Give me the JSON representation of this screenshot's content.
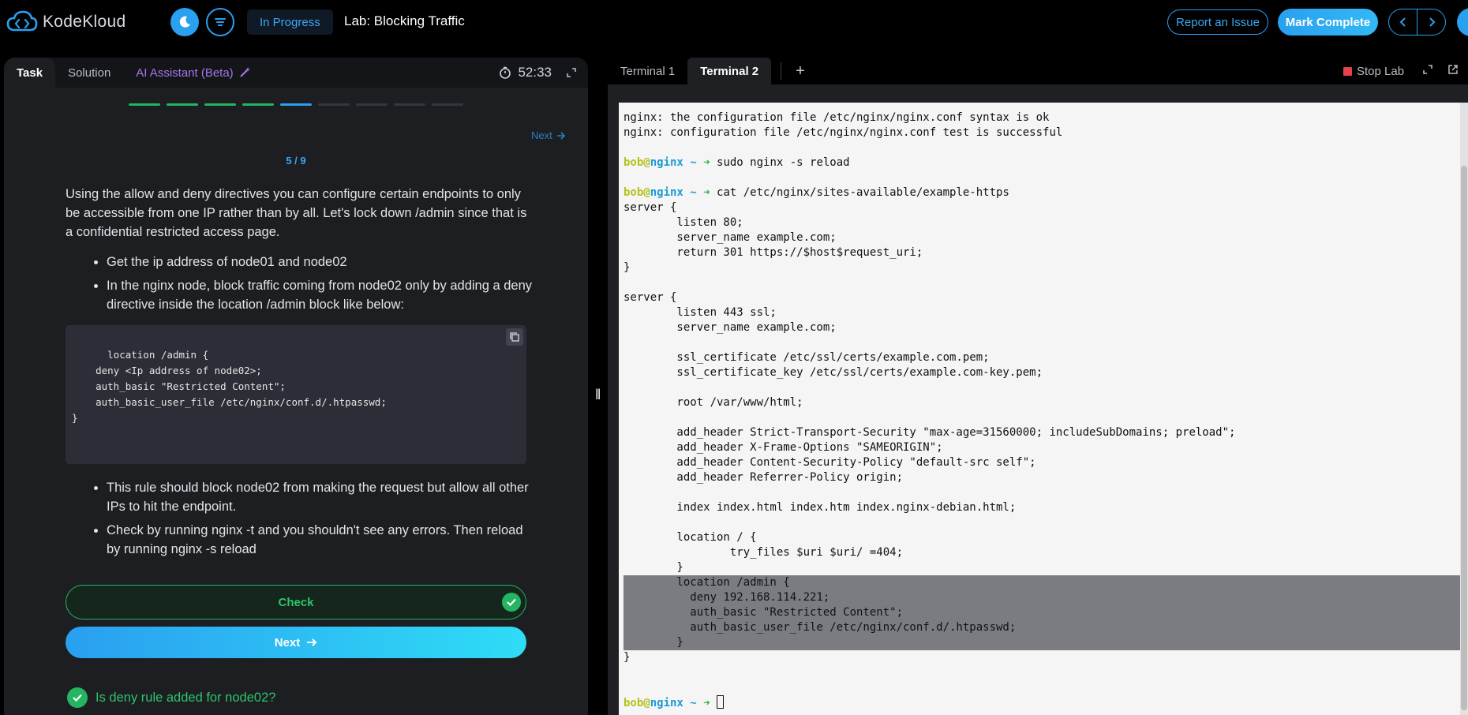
{
  "header": {
    "brand": "KodeKloud",
    "status": "In Progress",
    "lab_title": "Lab: Blocking Traffic",
    "report_label": "Report an Issue",
    "complete_label": "Mark Complete"
  },
  "left": {
    "tabs": [
      {
        "label": "Task"
      },
      {
        "label": "Solution"
      },
      {
        "label": "AI Assistant (Beta)"
      }
    ],
    "timer": "52:33",
    "next_link": "Next",
    "step": "5 / 9",
    "progress": {
      "done": 4,
      "current": 5,
      "total": 9
    },
    "intro": "Using the allow and deny directives you can configure certain endpoints to only be accessible from one IP rather than by all. Let's lock down /admin since that is a confidential restricted access page.",
    "bullets1": [
      "Get the ip address of node01 and node02",
      "In the nginx node, block traffic coming from node02 only by adding a deny directive inside the location /admin block like below:"
    ],
    "code": "location /admin {\n    deny <Ip address of node02>;\n    auth_basic \"Restricted Content\";\n    auth_basic_user_file /etc/nginx/conf.d/.htpasswd;\n}",
    "bullets2": [
      "This rule should block node02 from making the request but allow all other IPs to hit the endpoint.",
      "Check by running nginx -t and you shouldn't see any errors. Then reload by running nginx -s reload"
    ],
    "check_label": "Check",
    "next_label": "Next",
    "result_text": "Is deny rule added for node02?"
  },
  "right": {
    "tabs": [
      {
        "label": "Terminal 1"
      },
      {
        "label": "Terminal 2"
      }
    ],
    "stop_label": "Stop Lab",
    "prompt": {
      "user": "bob",
      "host": "nginx",
      "path": "~"
    },
    "lines": [
      {
        "t": "nginx: the configuration file /etc/nginx/nginx.conf syntax is ok"
      },
      {
        "t": "nginx: configuration file /etc/nginx/nginx.conf test is successful"
      },
      {
        "t": ""
      },
      {
        "p": true,
        "t": "sudo nginx -s reload"
      },
      {
        "t": ""
      },
      {
        "p": true,
        "t": "cat /etc/nginx/sites-available/example-https"
      },
      {
        "t": "server {"
      },
      {
        "t": "        listen 80;"
      },
      {
        "t": "        server_name example.com;"
      },
      {
        "t": "        return 301 https://$host$request_uri;"
      },
      {
        "t": "}"
      },
      {
        "t": ""
      },
      {
        "t": "server {"
      },
      {
        "t": "        listen 443 ssl;"
      },
      {
        "t": "        server_name example.com;"
      },
      {
        "t": ""
      },
      {
        "t": "        ssl_certificate /etc/ssl/certs/example.com.pem;"
      },
      {
        "t": "        ssl_certificate_key /etc/ssl/certs/example.com-key.pem;"
      },
      {
        "t": ""
      },
      {
        "t": "        root /var/www/html;"
      },
      {
        "t": ""
      },
      {
        "t": "        add_header Strict-Transport-Security \"max-age=31560000; includeSubDomains; preload\";"
      },
      {
        "t": "        add_header X-Frame-Options \"SAMEORIGIN\";"
      },
      {
        "t": "        add_header Content-Security-Policy \"default-src self\";"
      },
      {
        "t": "        add_header Referrer-Policy origin;"
      },
      {
        "t": ""
      },
      {
        "t": "        index index.html index.htm index.nginx-debian.html;"
      },
      {
        "t": ""
      },
      {
        "t": "        location / {"
      },
      {
        "t": "                try_files $uri $uri/ =404;"
      },
      {
        "t": "        }"
      },
      {
        "h": true,
        "t": "        location /admin {"
      },
      {
        "h": true,
        "t": "          deny 192.168.114.221;"
      },
      {
        "h": true,
        "t": "          auth_basic \"Restricted Content\";"
      },
      {
        "h": true,
        "t": "          auth_basic_user_file /etc/nginx/conf.d/.htpasswd;"
      },
      {
        "h": true,
        "t": "        }"
      },
      {
        "t": "}"
      },
      {
        "t": ""
      },
      {
        "t": ""
      },
      {
        "p": true,
        "t": "",
        "cursor": true
      }
    ]
  },
  "colors": {
    "accent": "#2aa0f0",
    "success": "#25b562",
    "ai": "#a277e8"
  }
}
